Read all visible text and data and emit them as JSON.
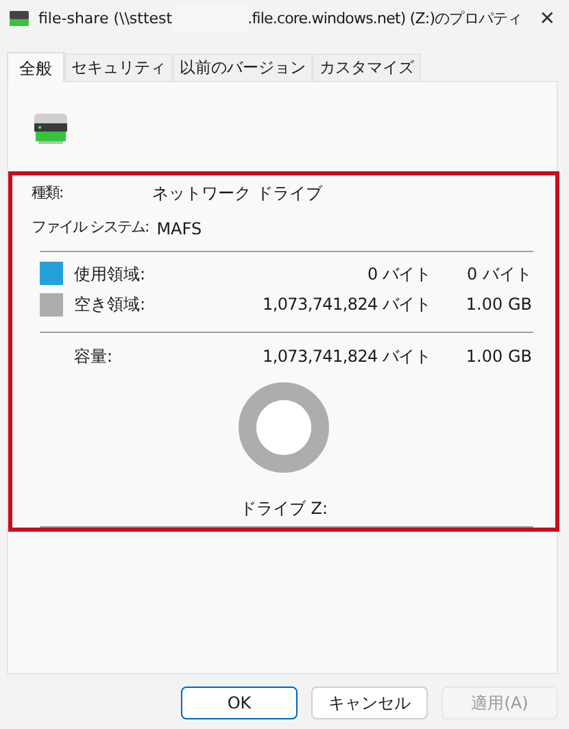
{
  "window": {
    "title_start": "file-share (\\\\sttest",
    "title_end": ".file.core.windows.net) (Z:)のプロパティ",
    "close": "✕"
  },
  "tabs": [
    {
      "label": "全般",
      "selected": true
    },
    {
      "label": "セキュリティ",
      "selected": false
    },
    {
      "label": "以前のバージョン",
      "selected": false
    },
    {
      "label": "カスタマイズ",
      "selected": false
    }
  ],
  "info": [
    {
      "label": "種類:",
      "value": "ネットワーク ドライブ"
    },
    {
      "label": "ファイル システム:",
      "value": "MAFS"
    }
  ],
  "space": [
    {
      "label": "使用領域:",
      "bytes": "0 バイト",
      "size": "0 バイト",
      "color": "#26a0da"
    },
    {
      "label": "空き領域:",
      "bytes": "1,073,741,824 バイト",
      "size": "1.00 GB",
      "color": "#adadad"
    }
  ],
  "capacity": {
    "label": "容量:",
    "bytes": "1,073,741,824 バイト",
    "size": "1.00 GB"
  },
  "drive_label": "ドライブ Z:",
  "buttons": [
    {
      "label": "OK",
      "kind": "default"
    },
    {
      "label": "キャンセル",
      "kind": "normal"
    },
    {
      "label": "適用(A)",
      "kind": "disabled"
    }
  ]
}
